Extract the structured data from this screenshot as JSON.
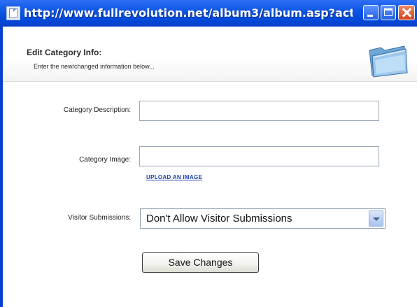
{
  "window": {
    "title": "http://www.fullrevolution.net/album3/album.asp?actio..."
  },
  "header": {
    "title": "Edit Category Info:",
    "subtitle": "Enter the new/changed information below..."
  },
  "form": {
    "description_label": "Category Description:",
    "description_value": "",
    "image_label": "Category Image:",
    "image_value": "",
    "upload_link": "UPLOAD AN IMAGE",
    "visitor_label": "Visitor Submissions:",
    "visitor_selected": "Don't Allow Visitor Submissions",
    "save_label": "Save Changes"
  },
  "icons": {
    "title": "page-icon",
    "folder": "folder-icon",
    "minimize": "minimize-icon",
    "maximize": "maximize-icon",
    "close": "close-icon"
  },
  "colors": {
    "titlebar": "#0b54e2",
    "link": "#1a3fae",
    "close_button": "#d2421d"
  }
}
